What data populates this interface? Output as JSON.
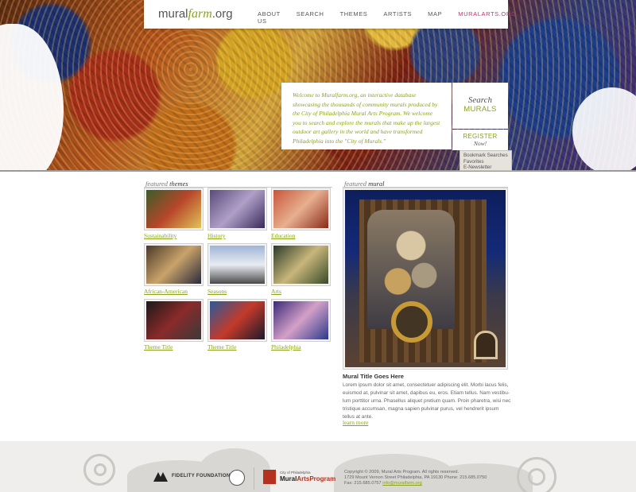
{
  "brand": {
    "prefix": "mural",
    "italic": "farm",
    "suffix": ".org"
  },
  "nav": [
    {
      "label": "ABOUT US"
    },
    {
      "label": "SEARCH"
    },
    {
      "label": "THEMES"
    },
    {
      "label": "ARTISTS"
    },
    {
      "label": "MAP"
    },
    {
      "label": "MURALARTS.ORG"
    }
  ],
  "welcome": "Welcome to Muralfarm.org, an interactive database showcasing the thousands of community murals produced by the City of Philadelphia Mural Arts Program. We welcome you to search and explore the murals that make up the largest outdoor art gallery in the world and have transformed Philadelphia into the \"City of Murals.\"",
  "search": {
    "line1": "Search",
    "line2": "MURALS"
  },
  "register": {
    "line1": "REGISTER",
    "line2": "Now!"
  },
  "register_menu": [
    "Bookmark Searches",
    "Favorites",
    "E-Newsletter"
  ],
  "themes": {
    "heading_prefix": "featured",
    "heading_main": "themes",
    "items": [
      {
        "label": "Sustainability"
      },
      {
        "label": "History"
      },
      {
        "label": "Education"
      },
      {
        "label": "African-American"
      },
      {
        "label": "Seasons"
      },
      {
        "label": "Arts"
      },
      {
        "label": "Theme Title"
      },
      {
        "label": "Theme Title"
      },
      {
        "label": "Philadelphia"
      }
    ]
  },
  "mural": {
    "heading_prefix": "featured",
    "heading_main": "mural",
    "title": "Mural Title Goes Here",
    "description": "Lorem ipsum dolor sit amet, consectetuer adipiscing elit. Morbi lacus felis, euismod at, pulvinar sit amet, dapibus eu, eros. Etiam tellus. Nam vestibu-lum porttitor urna. Phasellus aliquet pretium quam. Proin pharetra, wisi nec tristique accumsan, magna sapien pulvinar purus, vel hendrerit ipsum tellus at ante.",
    "learn_more": "learn more"
  },
  "footer": {
    "fidelity": "FIDELITY FOUNDATION",
    "map_small": "City of Philadelphia",
    "map_big_prefix": "Mural",
    "map_big_suffix": "ArtsProgram",
    "copyright": "Copyright © 2009, Mural Arts Program. All rights reserved.",
    "address": "1729 Mount Vernon Street Philadelphia, PA 19130 Phone: 215.685.0750",
    "fax": "Fax: 215.685.0757",
    "email": "info@muralfarm.org"
  },
  "colors": {
    "accent_green": "#8aa31d",
    "accent_pink": "#d6277e"
  }
}
